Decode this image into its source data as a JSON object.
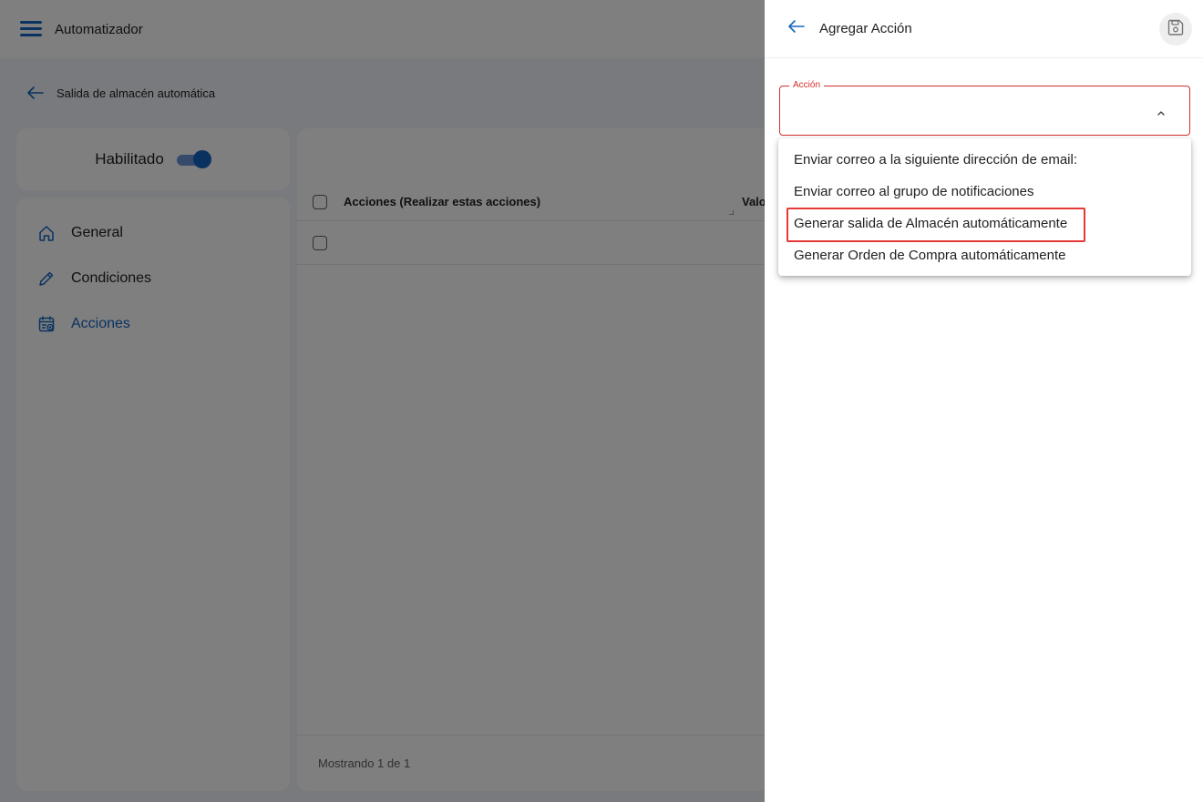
{
  "topbar": {
    "title": "Automatizador",
    "menu_icon": "hamburger-menu-icon"
  },
  "subbar": {
    "title": "Salida de almacén automática",
    "back_icon": "arrow-left-icon"
  },
  "status": {
    "label": "Habilitado",
    "enabled": true
  },
  "sidebar": {
    "items": [
      {
        "label": "General",
        "icon": "home-icon",
        "active": false
      },
      {
        "label": "Condiciones",
        "icon": "pencil-icon",
        "active": false
      },
      {
        "label": "Acciones",
        "icon": "calendar-add-icon",
        "active": true
      }
    ]
  },
  "table": {
    "columns": [
      "Acciones (Realizar estas acciones)",
      "Valo"
    ],
    "footer": "Mostrando 1 de 1"
  },
  "drawer": {
    "title": "Agregar Acción",
    "back_icon": "arrow-left-icon",
    "save_icon": "save-icon",
    "field": {
      "label": "Acción",
      "value": "",
      "options": [
        "Enviar correo a la siguiente dirección de email:",
        "Enviar correo al grupo de notificaciones",
        "Generar salida de Almacén automáticamente",
        "Generar Orden de Compra automáticamente"
      ],
      "highlighted_option": "Generar salida de Almacén automáticamente"
    }
  },
  "colors": {
    "accent": "#1565c0",
    "error": "#d32f2f",
    "highlight_border": "#e53935",
    "overlay": "rgba(0,0,0,0.5)"
  }
}
